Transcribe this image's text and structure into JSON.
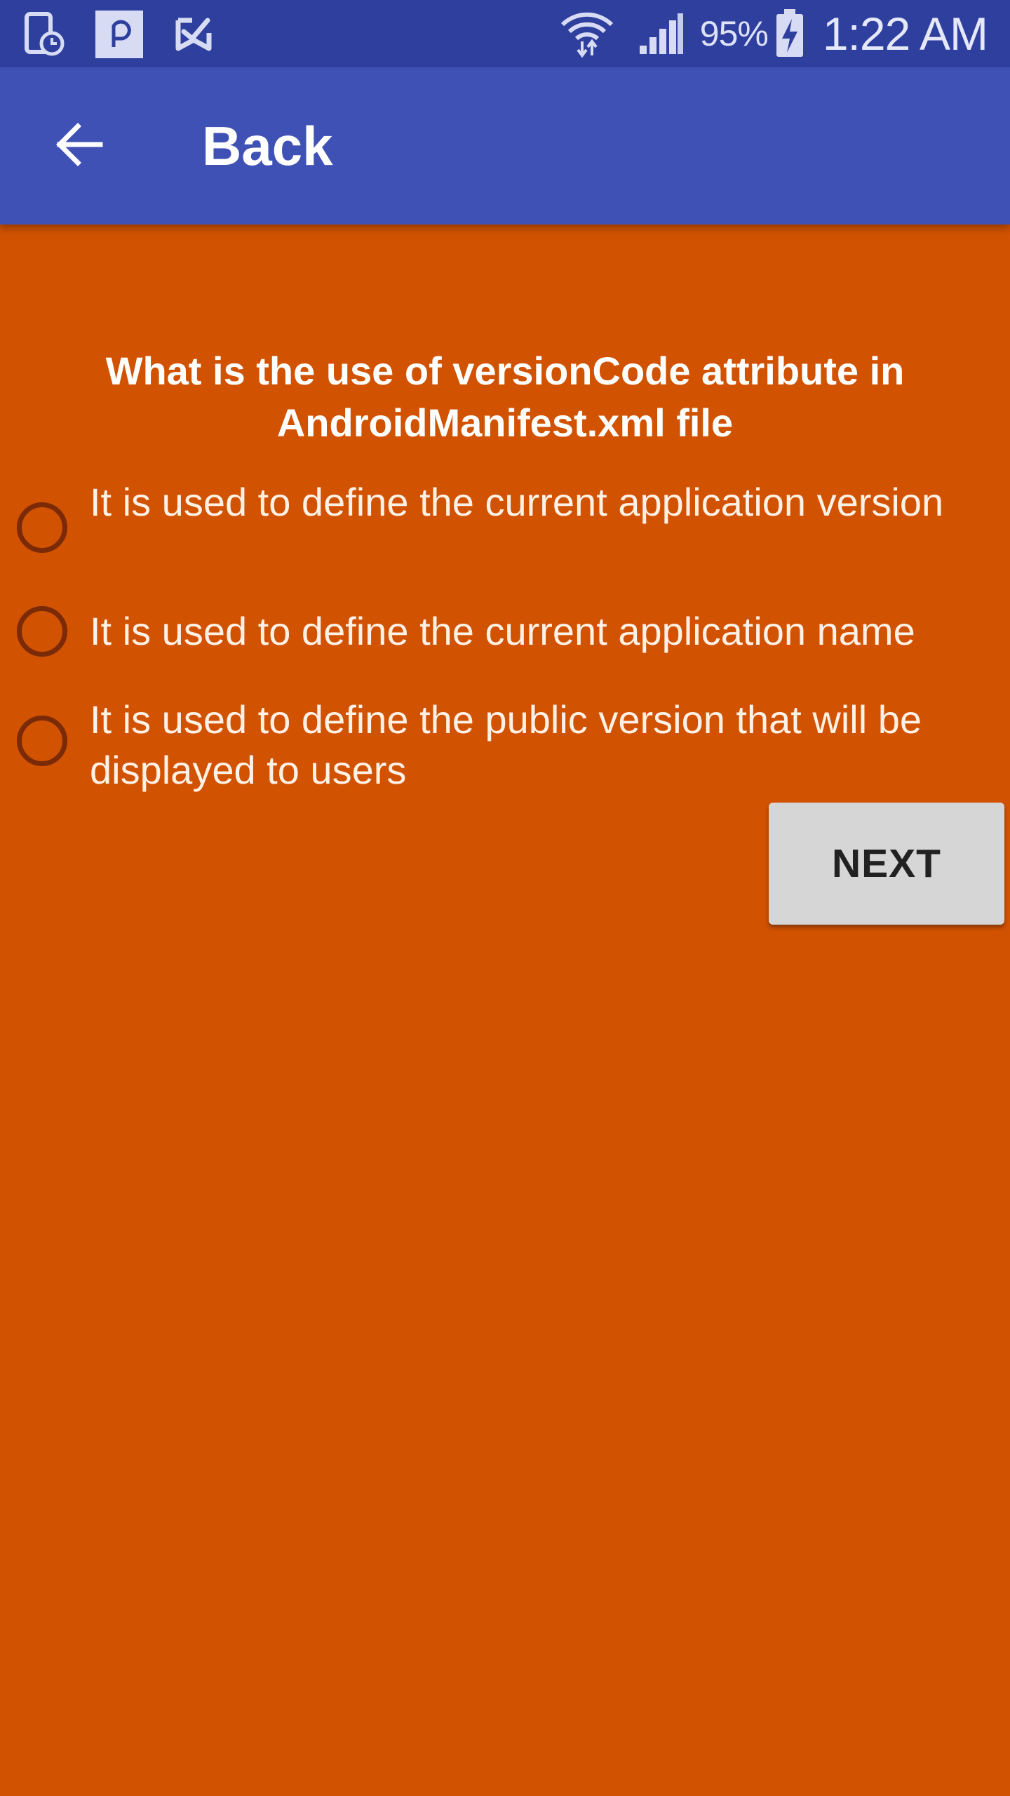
{
  "status_bar": {
    "icons_left": [
      "tablet-clock-icon",
      "p-app-icon",
      "task-check-icon"
    ],
    "icons_right": [
      "wifi-icon",
      "signal-icon",
      "battery-charging-icon"
    ],
    "battery_percent": "95%",
    "time": "1:22 AM"
  },
  "app_bar": {
    "back_icon": "arrow-left-icon",
    "title": "Back"
  },
  "quiz": {
    "question": "What is the use of versionCode attribute in AndroidManifest.xml file",
    "options": [
      {
        "label": "It is used to define the current application version",
        "selected": false
      },
      {
        "label": "It is used to define the current application name",
        "selected": false
      },
      {
        "label": "It is used to define the public version that will be displayed to users",
        "selected": false
      }
    ],
    "next_label": "NEXT"
  },
  "colors": {
    "status_bar": "#2F3F9E",
    "app_bar": "#3F51B5",
    "background": "#D15200",
    "radio_border": "#7A2A06",
    "button_bg": "#D6D6D6"
  }
}
